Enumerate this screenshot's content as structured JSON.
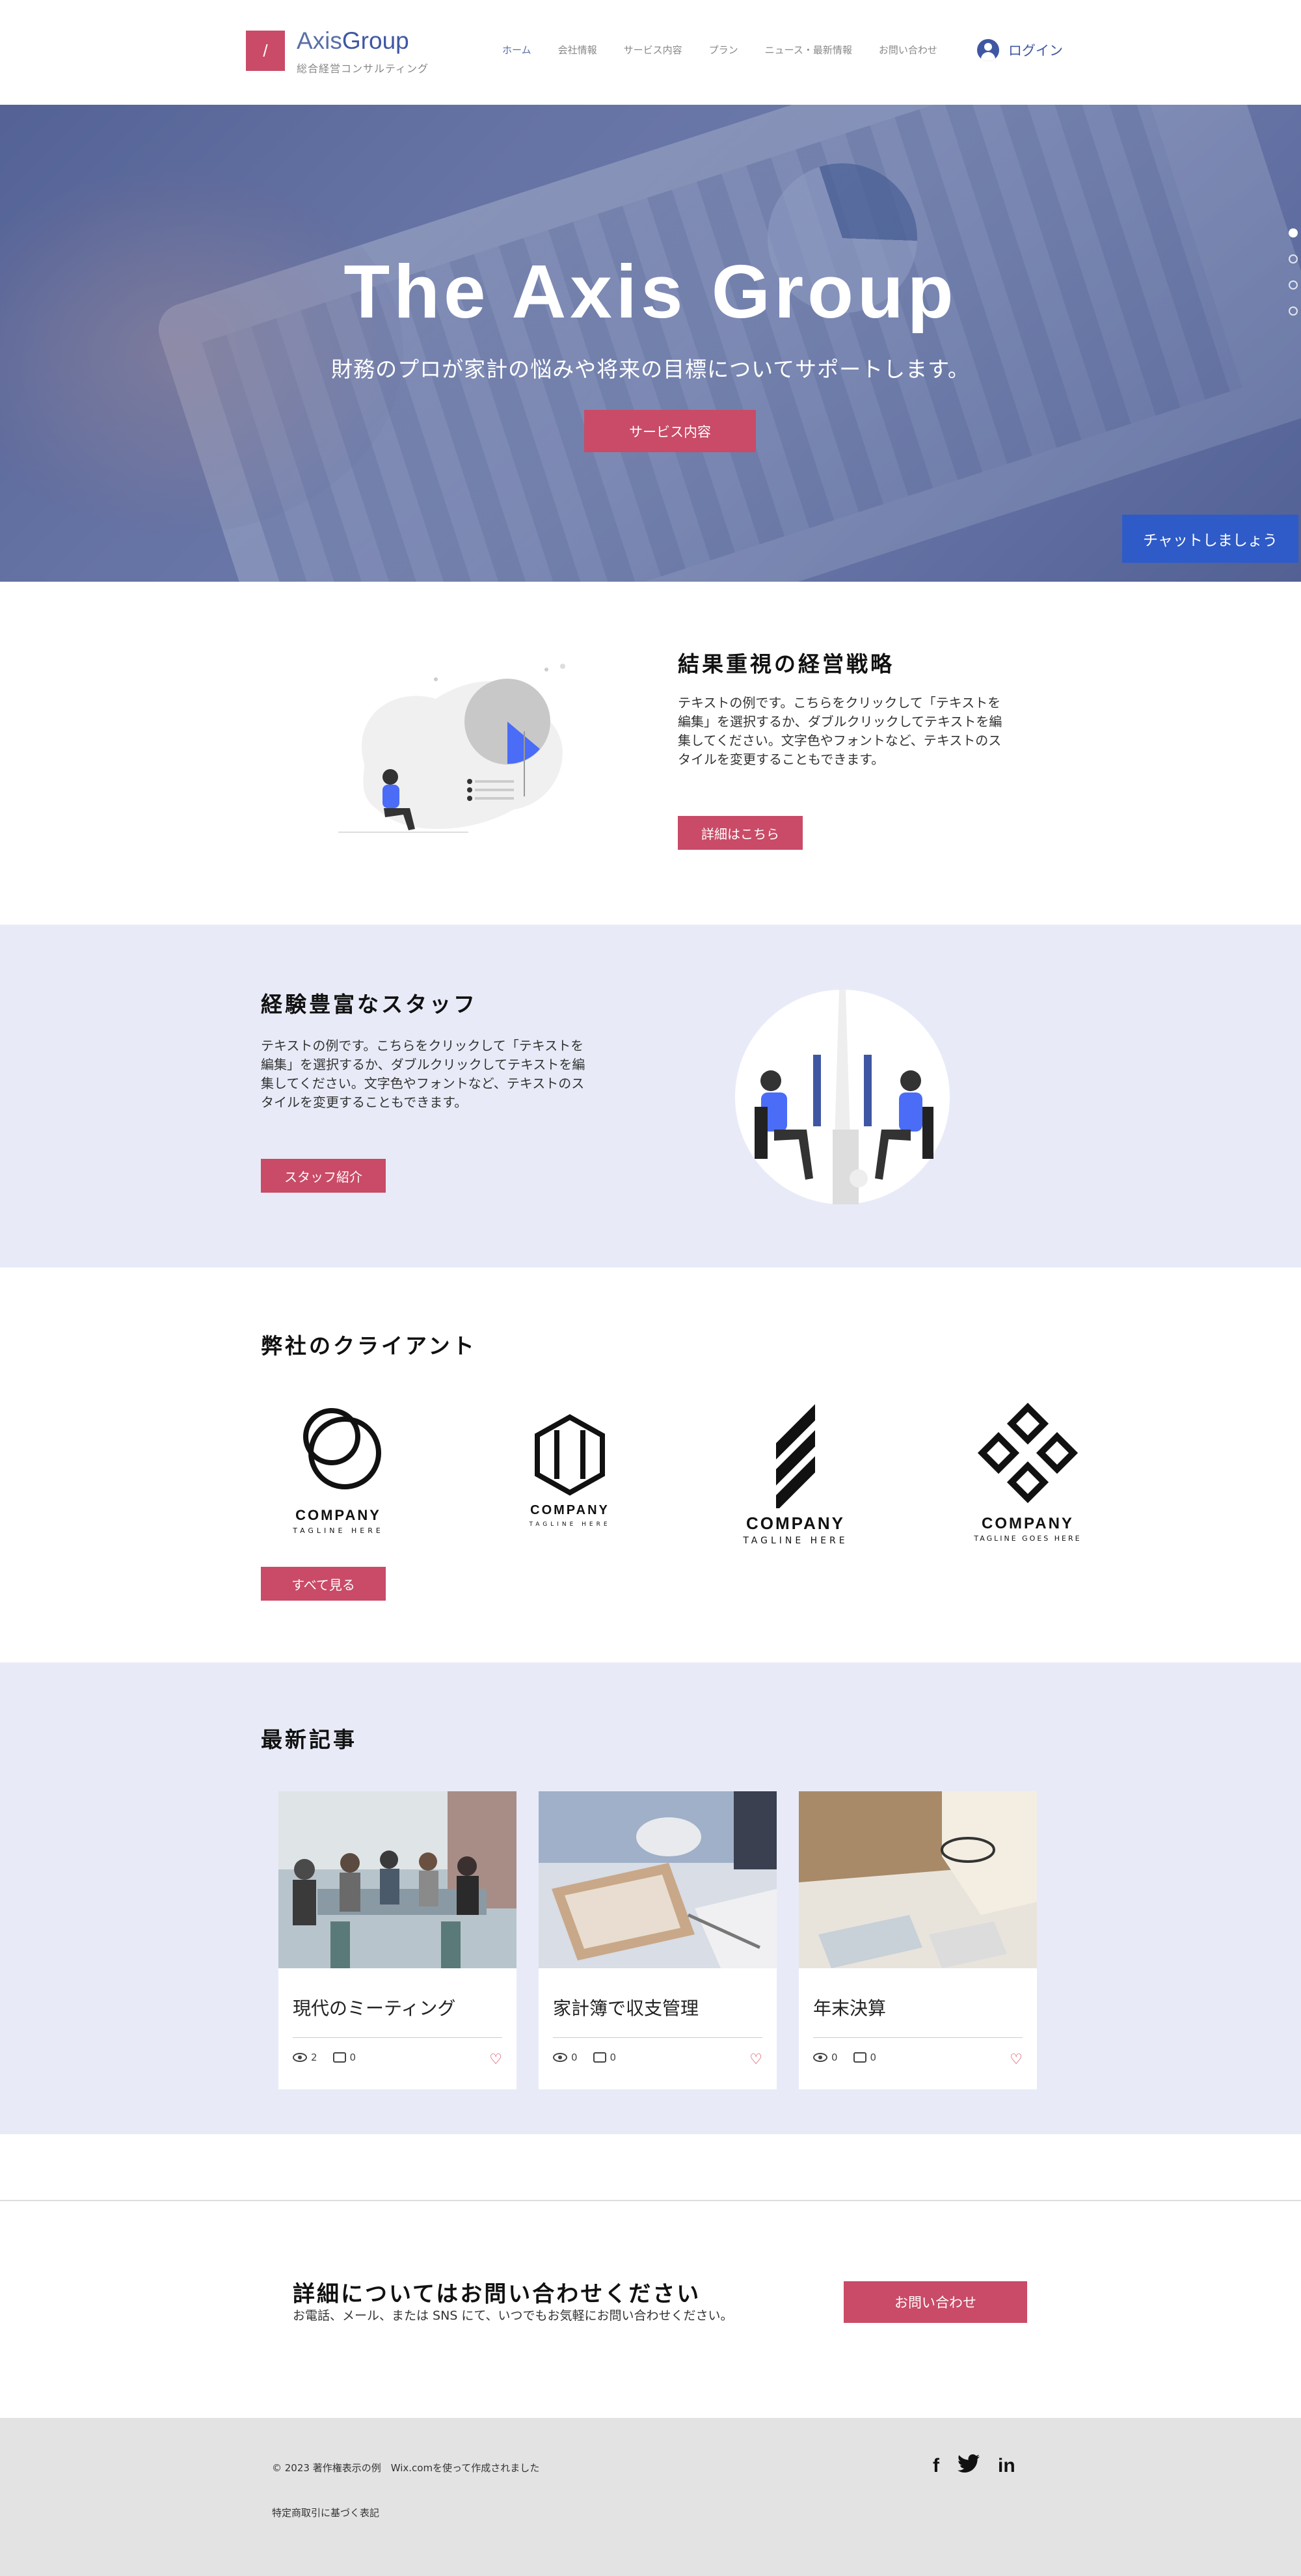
{
  "header": {
    "logo_mark": "/",
    "logo_name_a": "Axis",
    "logo_name_b": "Group",
    "logo_sub": "総合経営コンサルティング",
    "nav": [
      "ホーム",
      "会社情報",
      "サービス内容",
      "プラン",
      "ニュース・最新情報",
      "お問い合わせ"
    ],
    "login_label": "ログイン"
  },
  "hero": {
    "title": "The Axis Group",
    "subtitle": "財務のプロが家計の悩みや将来の目標についてサポートします。",
    "button": "サービス内容",
    "chat_button": "チャットしましょう"
  },
  "section_strategy": {
    "title": "結果重視の経営戦略",
    "text": "テキストの例です。こちらをクリックして「テキストを編集」を選択するか、ダブルクリックしてテキストを編集してください。文字色やフォントなど、テキストのスタイルを変更することもできます。",
    "button": "詳細はこちら"
  },
  "section_staff": {
    "title": "経験豊富なスタッフ",
    "text": "テキストの例です。こちらをクリックして「テキストを編集」を選択するか、ダブルクリックしてテキストを編集してください。文字色やフォントなど、テキストのスタイルを変更することもできます。",
    "button": "スタッフ紹介"
  },
  "clients": {
    "title": "弊社のクライアント",
    "logos": [
      {
        "name": "COMPANY",
        "tag": "TAGLINE HERE"
      },
      {
        "name": "COMPANY",
        "tag": "TAGLINE HERE"
      },
      {
        "name": "COMPANY",
        "tag": "TAGLINE HERE"
      },
      {
        "name": "COMPANY",
        "tag": "TAGLINE GOES HERE"
      }
    ],
    "button": "すべて見る"
  },
  "blog": {
    "title": "最新記事",
    "posts": [
      {
        "title": "現代のミーティング",
        "views": "2",
        "comments": "0"
      },
      {
        "title": "家計簿で収支管理",
        "views": "0",
        "comments": "0"
      },
      {
        "title": "年末決算",
        "views": "0",
        "comments": "0"
      }
    ]
  },
  "contact": {
    "title": "詳細についてはお問い合わせください",
    "text": "お電話、メール、または SNS にて、いつでもお気軽にお問い合わせください。",
    "button": "お問い合わせ"
  },
  "footer": {
    "copyright": "© 2023 著作権表示の例　Wix.comを使って作成されました",
    "legal": "特定商取引に基づく表記",
    "social": [
      "f",
      "t",
      "in"
    ]
  },
  "colors": {
    "accent": "#c94b67",
    "brand": "#3f57a3",
    "chat": "#2f5bc8",
    "section_bg": "#e8ebf7"
  }
}
